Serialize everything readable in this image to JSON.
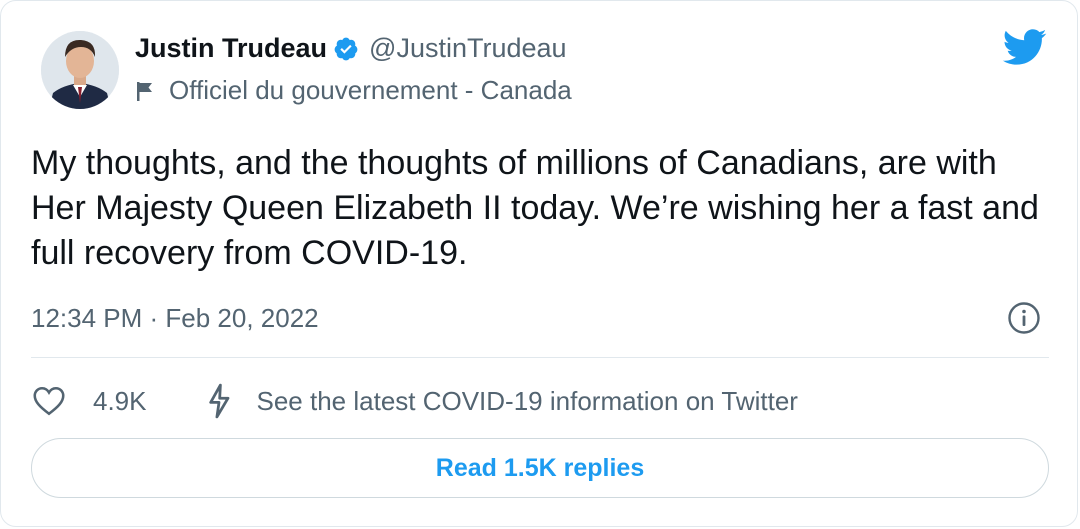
{
  "author": {
    "display_name": "Justin Trudeau",
    "handle": "@JustinTrudeau",
    "label": "Officiel du gouvernement - Canada",
    "avatar_icon": "avatar-photo",
    "verified_icon": "verified-badge-icon",
    "label_icon": "flag-icon"
  },
  "brand": {
    "logo_icon": "twitter-bird-icon",
    "accent_color": "#1d9bf0"
  },
  "tweet": {
    "text": "My thoughts, and the thoughts of millions of Canadians, are with Her Majesty Queen Elizabeth II today. We’re wishing her a fast and full recovery from COVID-19.",
    "timestamp": "12:34 PM · Feb 20, 2022",
    "info_icon": "info-icon"
  },
  "actions": {
    "like_icon": "heart-icon",
    "like_count": "4.9K",
    "covid_icon": "lightning-icon",
    "covid_link": "See the latest COVID-19 information on Twitter"
  },
  "replies": {
    "button_label": "Read 1.5K replies"
  }
}
